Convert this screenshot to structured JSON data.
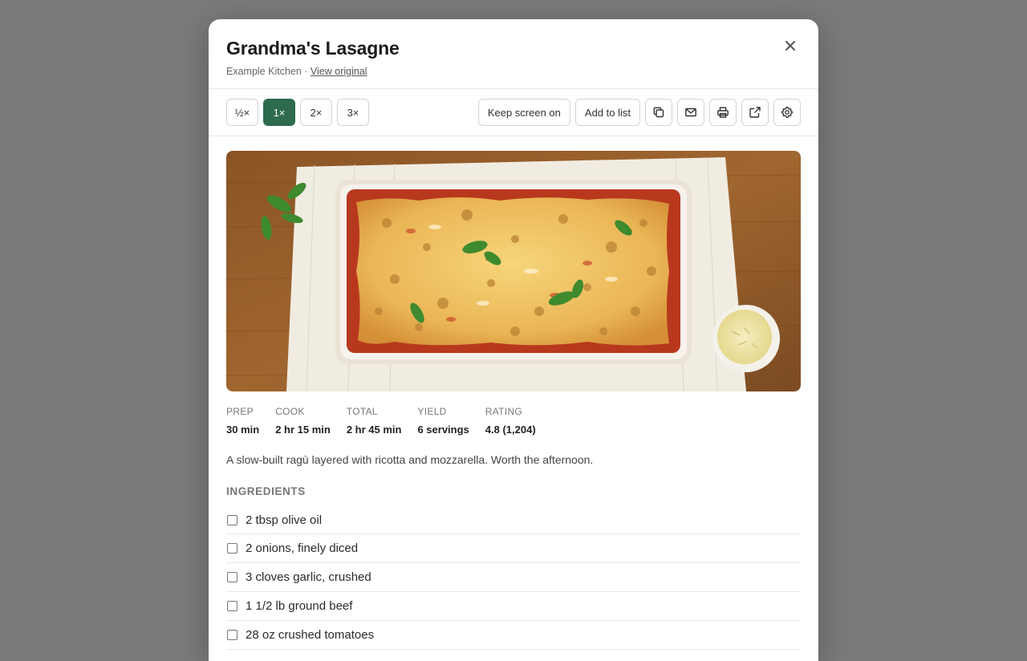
{
  "recipe": {
    "title": "Grandma's Lasagne",
    "source": "Example Kitchen",
    "separator": " · ",
    "view_original": "View original",
    "description": "A slow-built ragù layered with ricotta and mozzarella. Worth the afternoon."
  },
  "toolbar": {
    "scales": [
      {
        "label": "½×",
        "active": false
      },
      {
        "label": "1×",
        "active": true
      },
      {
        "label": "2×",
        "active": false
      },
      {
        "label": "3×",
        "active": false
      }
    ],
    "keep_screen_on": "Keep screen on",
    "add_to_list": "Add to list",
    "icons": [
      "copy-icon",
      "mail-icon",
      "print-icon",
      "external-link-icon",
      "gear-icon"
    ]
  },
  "stats": [
    {
      "label": "PREP",
      "value": "30 min"
    },
    {
      "label": "COOK",
      "value": "2 hr 15 min"
    },
    {
      "label": "TOTAL",
      "value": "2 hr 45 min"
    },
    {
      "label": "YIELD",
      "value": "6 servings"
    },
    {
      "label": "RATING",
      "value": "4.8 (1,204)"
    }
  ],
  "ingredients": {
    "heading": "INGREDIENTS",
    "items": [
      "2 tbsp olive oil",
      "2 onions, finely diced",
      "3 cloves garlic, crushed",
      "1 1/2 lb ground beef",
      "28 oz crushed tomatoes"
    ]
  },
  "colors": {
    "accent": "#2e6b4e",
    "overlay": "#7a7a7a"
  }
}
